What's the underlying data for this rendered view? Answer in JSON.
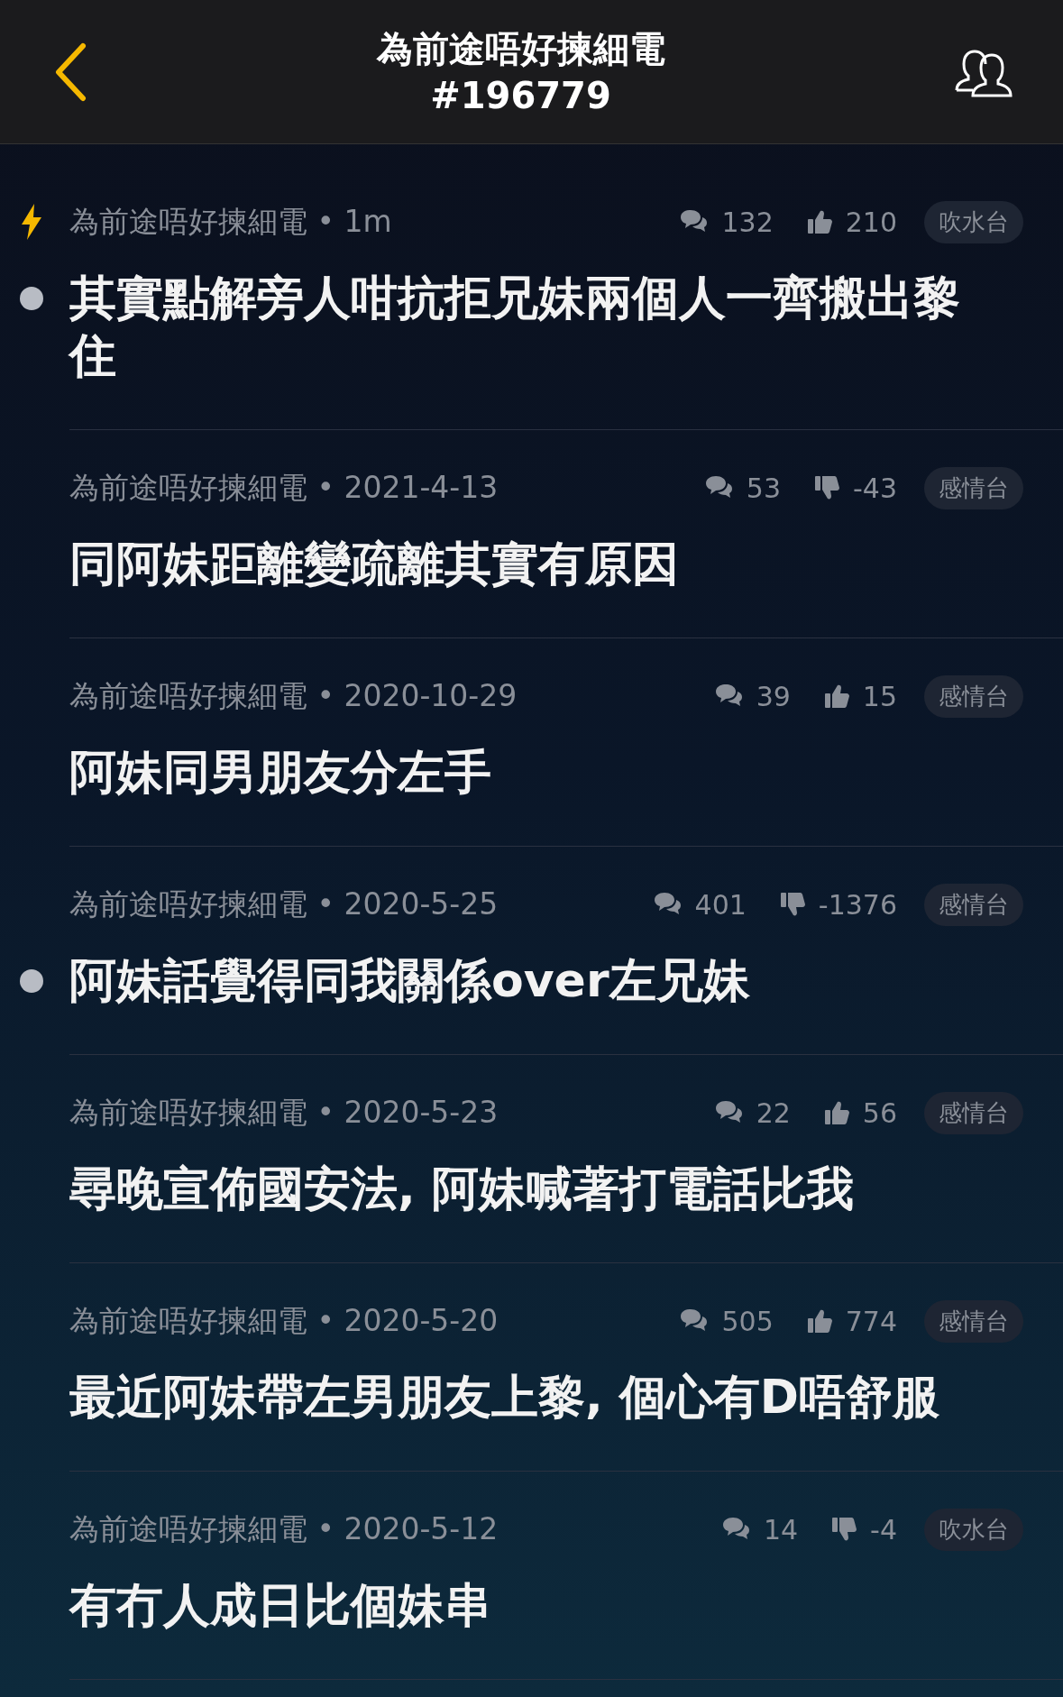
{
  "header": {
    "title": "為前途唔好揀細電",
    "thread_id": "#196779"
  },
  "threads": [
    {
      "hot": true,
      "unread": true,
      "byline": "為前途唔好揀細電 • 1m",
      "comments": "132",
      "kind": "upvote",
      "score": "210",
      "tag": "吹水台",
      "title": "其實點解旁人咁抗拒兄妹兩個人一齊搬出黎住"
    },
    {
      "hot": false,
      "unread": false,
      "byline": "為前途唔好揀細電 • 2021-4-13",
      "comments": "53",
      "kind": "downvote",
      "score": "-43",
      "tag": "感情台",
      "title": "同阿妹距離變疏離其實有原因"
    },
    {
      "hot": false,
      "unread": false,
      "byline": "為前途唔好揀細電 • 2020-10-29",
      "comments": "39",
      "kind": "upvote",
      "score": "15",
      "tag": "感情台",
      "title": "阿妹同男朋友分左手"
    },
    {
      "hot": false,
      "unread": true,
      "byline": "為前途唔好揀細電 • 2020-5-25",
      "comments": "401",
      "kind": "downvote",
      "score": "-1376",
      "tag": "感情台",
      "title": "阿妹話覺得同我關係over左兄妹"
    },
    {
      "hot": false,
      "unread": false,
      "byline": "為前途唔好揀細電 • 2020-5-23",
      "comments": "22",
      "kind": "upvote",
      "score": "56",
      "tag": "感情台",
      "title": "尋晚宣佈國安法, 阿妹喊著打電話比我"
    },
    {
      "hot": false,
      "unread": false,
      "byline": "為前途唔好揀細電 • 2020-5-20",
      "comments": "505",
      "kind": "upvote",
      "score": "774",
      "tag": "感情台",
      "title": "最近阿妹帶左男朋友上黎, 個心有D唔舒服"
    },
    {
      "hot": false,
      "unread": false,
      "byline": "為前途唔好揀細電 • 2020-5-12",
      "comments": "14",
      "kind": "downvote",
      "score": "-4",
      "tag": "吹水台",
      "title": "有冇人成日比個妹串"
    }
  ]
}
